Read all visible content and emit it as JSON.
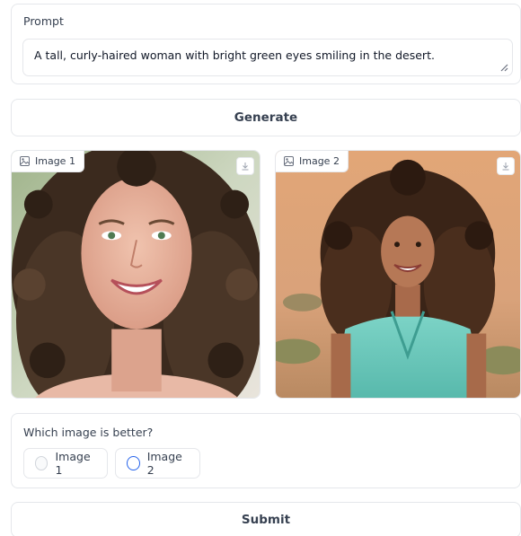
{
  "prompt": {
    "label": "Prompt",
    "value": "A tall, curly-haired woman with bright green eyes smiling in the desert."
  },
  "generate": {
    "label": "Generate"
  },
  "images": [
    {
      "label": "Image 1",
      "icon": "image-icon",
      "download_icon": "download-icon"
    },
    {
      "label": "Image 2",
      "icon": "image-icon",
      "download_icon": "download-icon"
    }
  ],
  "choice": {
    "question": "Which image is better?",
    "options": [
      {
        "label": "Image 1",
        "selected": false
      },
      {
        "label": "Image 2",
        "selected": false
      }
    ]
  },
  "submit": {
    "label": "Submit"
  },
  "colors": {
    "border": "#e5e7eb",
    "accent": "#2563eb",
    "text": "#374151"
  }
}
